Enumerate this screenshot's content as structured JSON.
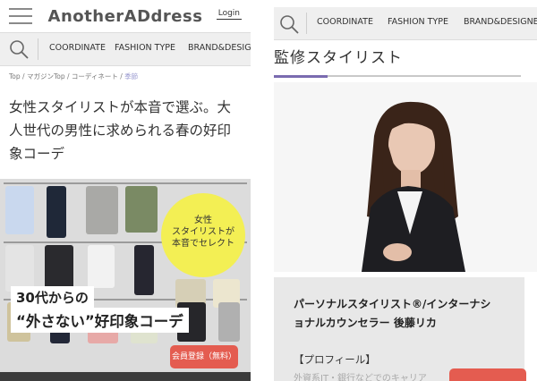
{
  "left": {
    "logo": "AnotherADdress",
    "login": "Login",
    "nav": [
      "COORDINATE",
      "FASHION TYPE",
      "BRAND&DESIGNER"
    ],
    "breadcrumb": {
      "items": [
        "Top",
        "マガジンTop",
        "コーディネート"
      ],
      "current": "季節",
      "separator": " / "
    },
    "title_lines": [
      "女性スタイリストが本音で選ぶ。大",
      "人世代の男性に求められる春の好印",
      "象コーデ"
    ],
    "hero": {
      "circle_lines": [
        "女性",
        "スタイリストが",
        "本音でセレクト"
      ],
      "banner_line1": "30代からの",
      "banner_line2": "“外さない”好印象コーデ",
      "circle_color": "#f3ef54"
    },
    "member_button": "会員登録（無料）"
  },
  "right": {
    "nav": [
      "COORDINATE",
      "FASHION TYPE",
      "BRAND&DESIGNER"
    ],
    "section_title": "監修スタイリスト",
    "card_title_lines": [
      "パーソナルスタイリスト®/インターナシ",
      "ョナルカウンセラー 後藤リカ"
    ],
    "profile_label": "【プロフィール】",
    "faint_text": "外資系IT・銀行などでのキャリア"
  },
  "colors": {
    "accent_underline": "#7a6bb0",
    "button_red": "#e45c50",
    "nav_bg": "#efefef"
  }
}
